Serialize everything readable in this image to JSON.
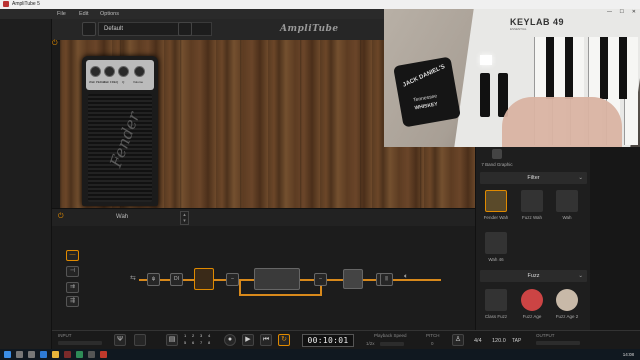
{
  "window": {
    "title": "AmpliTube 5"
  },
  "menu": [
    "File",
    "Edit",
    "Options"
  ],
  "toolbar": {
    "preset": "Default",
    "brand": "AmpliTube"
  },
  "stage": {
    "pedal_knob_labels": [
      "Wah PEDAL",
      "Wah FREQ",
      "",
      "Q",
      "Volume"
    ]
  },
  "pedal_selector": {
    "name": "Wah"
  },
  "chain": {
    "nodes": [
      "DI"
    ]
  },
  "transport": {
    "input_label": "INPUT",
    "output_label": "OUTPUT",
    "time": "00:10:01",
    "playback_label": "Playback Speed",
    "playback_value": "1/2x",
    "pitch_label": "PITCH",
    "pitch_value": "0",
    "sig": "4/4",
    "bpm": "120.0",
    "tap": "TAP",
    "grid": [
      "1",
      "2",
      "3",
      "4",
      "5",
      "6",
      "7",
      "8"
    ]
  },
  "browser": {
    "top_item": "7 Band Graphic",
    "cat_filter": "Filter",
    "filter_items": [
      "Fender Wah",
      "Fuzz Wah",
      "Wah",
      "Wah 46"
    ],
    "cat_fuzz": "Fuzz",
    "fuzz_items": [
      "Class Fuzz",
      "Fuzz Age",
      "Fuzz Age 2"
    ]
  },
  "webcam": {
    "keyboard_brand": "KEYLAB",
    "keyboard_model": "49",
    "keyboard_sub": "ESSENTIAL",
    "coaster_line1": "JACK DANIEL'S",
    "coaster_line2": "Tennessee",
    "coaster_line3": "WHISKEY"
  },
  "taskbar": {
    "clock": "14:08"
  },
  "colors": {
    "accent": "#e08a00",
    "wire": "#d8891b",
    "bg": "#1a1a1a"
  }
}
